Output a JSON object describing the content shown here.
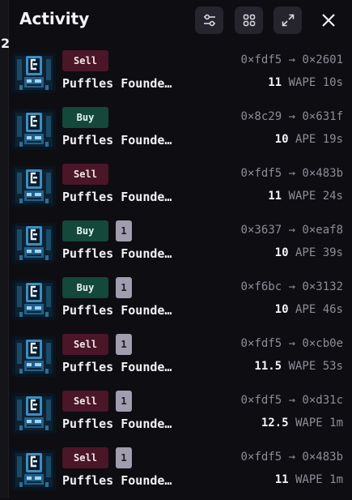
{
  "edge": {
    "glyph": "2"
  },
  "panel": {
    "title": "Activity"
  },
  "header": {
    "filter_icon": "sliders-icon",
    "grid_icon": "grid-icon",
    "expand_icon": "expand-icon",
    "close_icon": "close-icon"
  },
  "items": [
    {
      "type": "Sell",
      "count": "",
      "name": "Puffles Founde…",
      "from": "0×fdf5",
      "to": "0×2601",
      "amount": "11",
      "currency": "WAPE",
      "time": "10s"
    },
    {
      "type": "Buy",
      "count": "",
      "name": "Puffles Founde…",
      "from": "0×8c29",
      "to": "0×631f",
      "amount": "10",
      "currency": "APE",
      "time": "19s"
    },
    {
      "type": "Sell",
      "count": "",
      "name": "Puffles Founde…",
      "from": "0×fdf5",
      "to": "0×483b",
      "amount": "11",
      "currency": "WAPE",
      "time": "24s"
    },
    {
      "type": "Buy",
      "count": "1",
      "name": "Puffles Founde…",
      "from": "0×3637",
      "to": "0×eaf8",
      "amount": "10",
      "currency": "APE",
      "time": "39s"
    },
    {
      "type": "Buy",
      "count": "1",
      "name": "Puffles Founde…",
      "from": "0×f6bc",
      "to": "0×3132",
      "amount": "10",
      "currency": "APE",
      "time": "46s"
    },
    {
      "type": "Sell",
      "count": "1",
      "name": "Puffles Founde…",
      "from": "0×fdf5",
      "to": "0×cb0e",
      "amount": "11.5",
      "currency": "WAPE",
      "time": "53s"
    },
    {
      "type": "Sell",
      "count": "1",
      "name": "Puffles Founde…",
      "from": "0×fdf5",
      "to": "0×d31c",
      "amount": "12.5",
      "currency": "WAPE",
      "time": "1m"
    },
    {
      "type": "Sell",
      "count": "1",
      "name": "Puffles Founde…",
      "from": "0×fdf5",
      "to": "0×483b",
      "amount": "11",
      "currency": "WAPE",
      "time": "1m"
    }
  ],
  "colors": {
    "sell": "#4a1628",
    "buy": "#13483a",
    "background": "#0e0d12",
    "muted": "#8e8d96"
  }
}
